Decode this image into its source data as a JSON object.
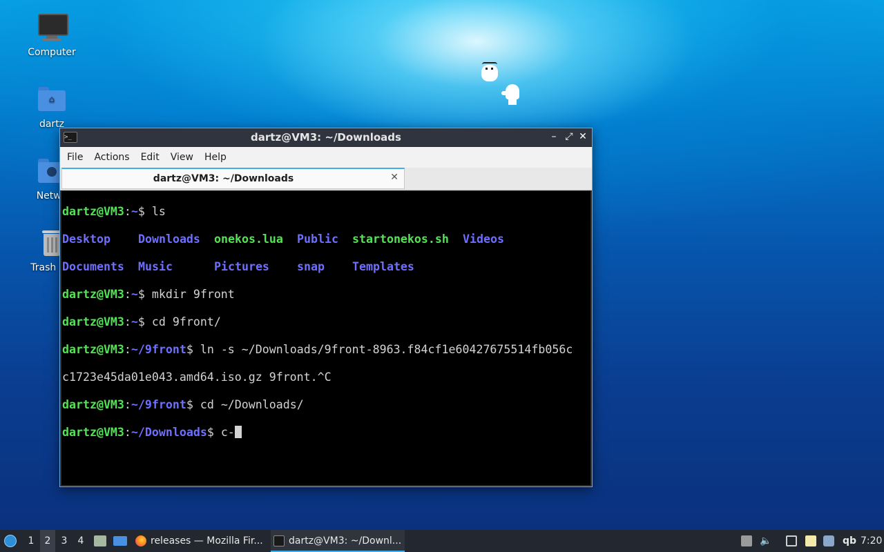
{
  "desktop": {
    "icons": [
      {
        "label": "Computer",
        "icon": "monitor-icon"
      },
      {
        "label": "dartz",
        "icon": "home-folder-icon"
      },
      {
        "label": "Netwo",
        "icon": "network-folder-icon"
      },
      {
        "label": "Trash (Er",
        "icon": "trash-icon"
      }
    ]
  },
  "window": {
    "title": "dartz@VM3: ~/Downloads",
    "minimize": "–",
    "maximize": "⤢",
    "close": "✕",
    "menu": [
      "File",
      "Actions",
      "Edit",
      "View",
      "Help"
    ],
    "tab": {
      "title": "dartz@VM3: ~/Downloads",
      "close": "✕"
    }
  },
  "terminal": {
    "prompt_user": "dartz@VM3",
    "sep": ":",
    "lines": [
      {
        "path": "~",
        "cmd": "ls"
      },
      {
        "path": "~/9front",
        "cmd": "ln -s ~/Downloads/9front-8963.f84cf1e60427675514fb056c"
      },
      {
        "path": "~/9front",
        "cmd": "cd ~/Downloads/"
      },
      {
        "path": "~/Downloads",
        "cmd": "c-"
      }
    ],
    "ls_row1": [
      "Desktop",
      "Downloads",
      "onekos.lua",
      "Public",
      "startonekos.sh",
      "Videos"
    ],
    "ls_row2": [
      "Documents",
      "Music",
      "Pictures",
      "snap",
      "Templates"
    ],
    "mkdir": {
      "path": "~",
      "cmd": "mkdir 9front"
    },
    "cd9": {
      "path": "~",
      "cmd": "cd 9front/"
    },
    "wrap": "c1723e45da01e043.amd64.iso.gz 9front.^C"
  },
  "taskbar": {
    "workspaces": [
      "1",
      "2",
      "3",
      "4"
    ],
    "active_workspace": "2",
    "tasks": [
      {
        "label": "releases — Mozilla Fir...",
        "icon": "firefox-icon"
      },
      {
        "label": "dartz@VM3: ~/Downl...",
        "icon": "terminal-icon"
      }
    ],
    "tray_text": "qb",
    "clock": "7:20"
  },
  "colors": {
    "prompt_green": "#54e354",
    "path_blue": "#6f6fff",
    "accent": "#3daee9",
    "titlebar": "#2f343f"
  }
}
